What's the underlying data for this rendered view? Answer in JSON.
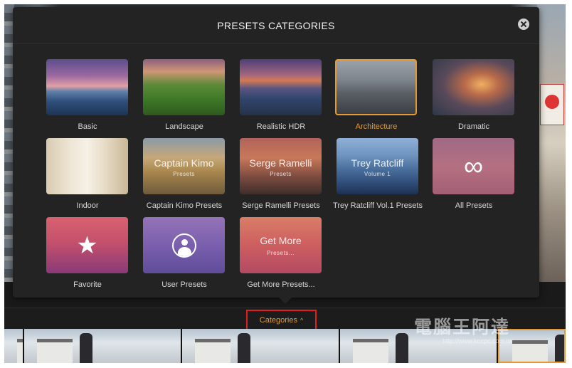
{
  "dialog": {
    "title": "PRESETS CATEGORIES"
  },
  "categories": [
    {
      "label": "Basic",
      "style": "basic",
      "selected": false
    },
    {
      "label": "Landscape",
      "style": "landscape",
      "selected": false
    },
    {
      "label": "Realistic HDR",
      "style": "realistic",
      "selected": false
    },
    {
      "label": "Architecture",
      "style": "architecture",
      "selected": true
    },
    {
      "label": "Dramatic",
      "style": "dramatic",
      "selected": false
    },
    {
      "label": "Indoor",
      "style": "indoor",
      "selected": false
    },
    {
      "label": "Captain Kimo Presets",
      "style": "kimo",
      "selected": false,
      "thumb_title": "Captain Kimo",
      "thumb_subtitle": "Presets"
    },
    {
      "label": "Serge Ramelli Presets",
      "style": "serge",
      "selected": false,
      "thumb_title": "Serge Ramelli",
      "thumb_subtitle": "Presets"
    },
    {
      "label": "Trey Ratcliff Vol.1 Presets",
      "style": "trey",
      "selected": false,
      "thumb_title": "Trey Ratcliff",
      "thumb_subtitle": "Volume 1"
    },
    {
      "label": "All Presets",
      "style": "allpresets",
      "selected": false,
      "icon": "infinity-icon"
    },
    {
      "label": "Favorite",
      "style": "favorite",
      "selected": false,
      "icon": "star-icon"
    },
    {
      "label": "User Presets",
      "style": "userpresets",
      "selected": false,
      "icon": "user-icon"
    },
    {
      "label": "Get More Presets...",
      "style": "getmore",
      "selected": false,
      "thumb_title": "Get More",
      "thumb_subtitle": "Presets..."
    }
  ],
  "bottom_bar": {
    "categories_label": "Categories",
    "accent_color": "#e49a35",
    "highlight_color": "#e02020"
  },
  "watermark": {
    "title": "電腦王阿達",
    "url": "http://www.kocpc.com.tw"
  }
}
